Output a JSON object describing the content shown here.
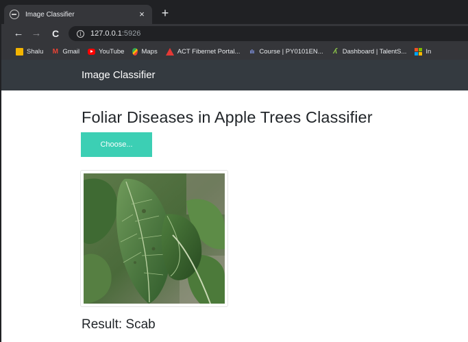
{
  "browser": {
    "tab": {
      "title": "Image Classifier",
      "close_glyph": "×",
      "favicon": "globe-icon"
    },
    "new_tab_glyph": "+",
    "toolbar": {
      "back_glyph": "←",
      "forward_glyph": "→",
      "reload_glyph": "C"
    },
    "address": {
      "info_glyph": "i",
      "host": "127.0.0.1",
      "port": ":5926"
    },
    "bookmarks": [
      {
        "label": "Shalu",
        "icon": "folder-icon"
      },
      {
        "label": "Gmail",
        "icon": "gmail-icon",
        "glyph": "M"
      },
      {
        "label": "YouTube",
        "icon": "youtube-icon"
      },
      {
        "label": "Maps",
        "icon": "maps-icon"
      },
      {
        "label": "ACT Fibernet Portal...",
        "icon": "act-icon"
      },
      {
        "label": "Course | PY0101EN...",
        "icon": "course-icon",
        "glyph": "ılı"
      },
      {
        "label": "Dashboard | TalentS...",
        "icon": "dashboard-icon",
        "glyph": "ʎ"
      },
      {
        "label": "In",
        "icon": "microsoft-icon"
      }
    ]
  },
  "app": {
    "brand": "Image Classifier",
    "title": "Foliar Diseases in Apple Trees Classifier",
    "choose_label": "Choose...",
    "image_subject": "apple-leaf-image",
    "result_label": "Result: Scab"
  },
  "colors": {
    "navbar": "#343a40",
    "accent": "#3ccfb4",
    "browser_dark": "#202124",
    "browser_toolbar": "#35363a"
  }
}
